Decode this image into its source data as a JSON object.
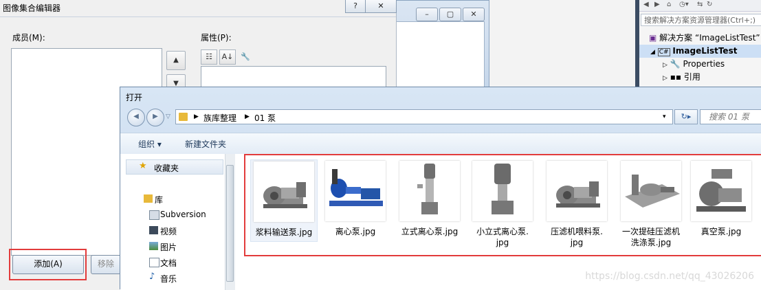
{
  "background_window": {
    "controls": [
      "–",
      "▢",
      "✕"
    ]
  },
  "editor": {
    "title": "图像集合编辑器",
    "help_btn": "?",
    "close_btn": "✕",
    "members_label": "成员(M):",
    "properties_label": "属性(P):",
    "add_button": "添加(A)",
    "remove_button": "移除"
  },
  "solution_explorer": {
    "search_placeholder": "搜索解决方案资源管理器(Ctrl+;)",
    "items": [
      {
        "label": "解决方案 “ImageListTest”"
      },
      {
        "label": "ImageListTest"
      },
      {
        "label": "Properties"
      },
      {
        "label": "引用"
      }
    ]
  },
  "dialog": {
    "title": "打开",
    "breadcrumb": [
      "族库整理",
      "01 泵"
    ],
    "search_placeholder": "搜索 01 泵",
    "organize": "组织 ▾",
    "new_folder": "新建文件夹",
    "nav": {
      "favorites": "收藏夹",
      "library": "库",
      "items": [
        "Subversion",
        "视频",
        "图片",
        "文档",
        "音乐"
      ]
    },
    "files": [
      {
        "name": "浆料输送泵.jpg",
        "type": "slurry"
      },
      {
        "name": "离心泵.jpg",
        "type": "blue"
      },
      {
        "name": "立式离心泵.jpg",
        "type": "vertical"
      },
      {
        "name": "小立式离心泵.\njpg",
        "type": "vertical2"
      },
      {
        "name": "压滤机喂料泵.\njpg",
        "type": "slurry"
      },
      {
        "name": "一次提硅压滤机\n洗涤泵.jpg",
        "type": "flat"
      },
      {
        "name": "真空泵.jpg",
        "type": "vacuum"
      }
    ]
  },
  "watermark": "https://blog.csdn.net/qq_43026206",
  "colors": {
    "highlight": "#e23b3b",
    "accent": "#1f5fa8"
  }
}
